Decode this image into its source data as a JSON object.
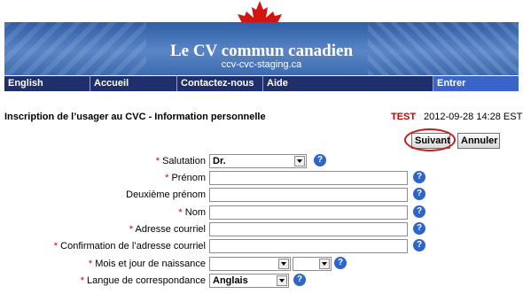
{
  "header": {
    "title": "Le CV commun canadien",
    "subtitle": "ccv-cvc-staging.ca"
  },
  "nav": {
    "items": [
      "English",
      "Accueil",
      "Contactez-nous",
      "Aide",
      "Entrer"
    ]
  },
  "page": {
    "heading": "Inscription de l’usager au CVC - Information personnelle",
    "env_label": "TEST",
    "datetime": "2012-09-28 14:28 EST"
  },
  "buttons": {
    "next": "Suivant",
    "cancel": "Annuler"
  },
  "form": {
    "required_mark": "*",
    "salutation": {
      "label": "Salutation",
      "value": "Dr."
    },
    "first_name": {
      "label": "Prénom",
      "value": ""
    },
    "middle_name": {
      "label": "Deuxième prénom",
      "value": ""
    },
    "last_name": {
      "label": "Nom",
      "value": ""
    },
    "email": {
      "label": "Adresse courriel",
      "value": ""
    },
    "email_confirm": {
      "label": "Confirmation de l’adresse courriel",
      "value": ""
    },
    "birth": {
      "label": "Mois et jour de naissance",
      "month": "",
      "day": ""
    },
    "language": {
      "label": "Langue de correspondance",
      "value": "Anglais"
    }
  },
  "icons": {
    "help": "?",
    "help_color": "#2d66c8",
    "leaf_color": "#d4140f"
  }
}
